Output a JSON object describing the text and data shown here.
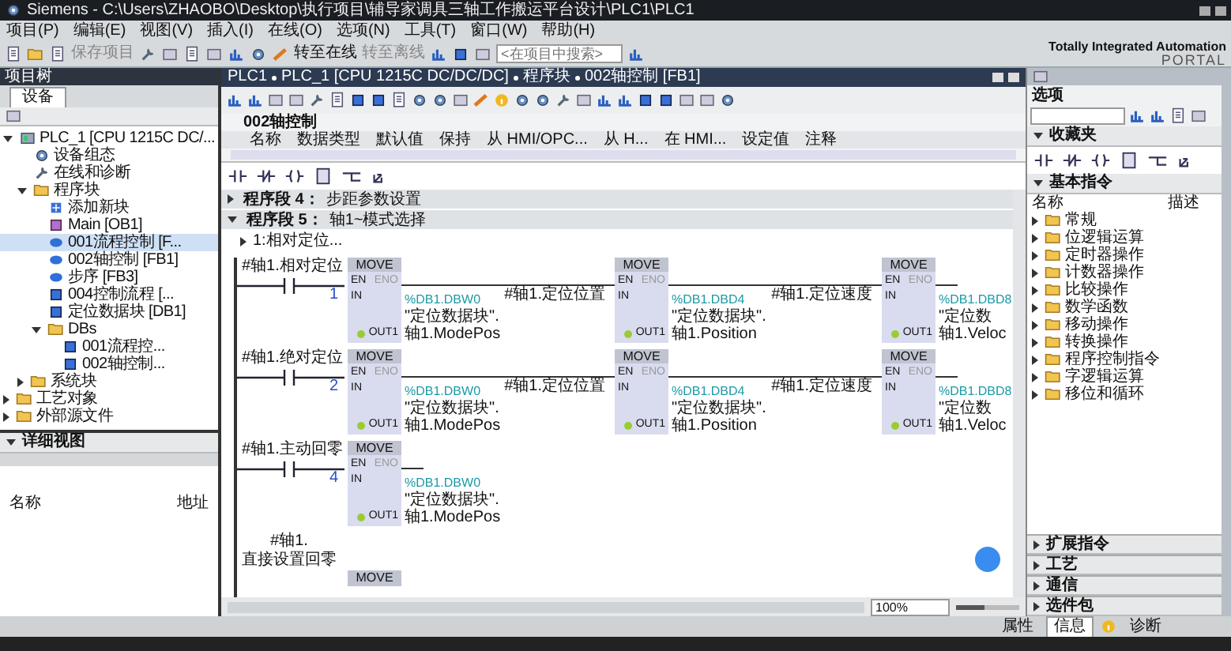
{
  "window": {
    "title": "Siemens - C:\\Users\\ZHAOBO\\Desktop\\执行项目\\辅导家调具三轴工作搬运平台设计\\PLC1\\PLC1"
  },
  "menu": [
    "项目(P)",
    "编辑(E)",
    "视图(V)",
    "插入(I)",
    "在线(O)",
    "选项(N)",
    "工具(T)",
    "窗口(W)",
    "帮助(H)"
  ],
  "toolbar": {
    "buttons": [
      {
        "label": "保存项目",
        "disabled": true
      },
      {
        "label": "转至在线",
        "disabled": false
      },
      {
        "label": "转至离线",
        "disabled": true
      }
    ],
    "search": {
      "placeholder": "<在项目中搜索>"
    },
    "brand": [
      "Totally Integrated Automation",
      "PORTAL"
    ]
  },
  "project_tree": {
    "title": "项目树",
    "tabs": [
      {
        "label": "设备",
        "selected": true
      }
    ],
    "items": [
      {
        "label": "PLC_1 [CPU 1215C DC/...",
        "kind": "device",
        "selected": false,
        "expanded": true,
        "children": [
          {
            "label": "设备组态",
            "kind": "config",
            "selected": false
          },
          {
            "label": "在线和诊断",
            "kind": "diag",
            "selected": false
          },
          {
            "label": "程序块",
            "kind": "folder",
            "selected": false,
            "expanded": true,
            "children": [
              {
                "label": "添加新块",
                "kind": "add",
                "selected": false
              },
              {
                "label": "Main [OB1]",
                "kind": "ob",
                "selected": false
              },
              {
                "label": "001流程控制 [F...",
                "kind": "fb",
                "selected": true
              },
              {
                "label": "002轴控制 [FB1]",
                "kind": "fb",
                "selected": false
              },
              {
                "label": "步序 [FB3]",
                "kind": "fb",
                "selected": false
              },
              {
                "label": "004控制流程 [...",
                "kind": "db",
                "selected": false
              },
              {
                "label": "定位数据块 [DB1]",
                "kind": "db",
                "selected": false
              },
              {
                "label": "DBs",
                "kind": "folder",
                "selected": false,
                "expanded": true,
                "children": [
                  {
                    "label": "001流程控...",
                    "kind": "db",
                    "selected": false
                  },
                  {
                    "label": "002轴控制...",
                    "kind": "db",
                    "selected": false
                  }
                ]
              }
            ]
          },
          {
            "label": "系统块",
            "kind": "folder",
            "selected": false,
            "expanded": false
          }
        ]
      },
      {
        "label": "工艺对象",
        "kind": "folder",
        "selected": false,
        "expanded": false
      },
      {
        "label": "外部源文件",
        "kind": "folder",
        "selected": false,
        "expanded": false
      }
    ]
  },
  "detail_view": {
    "title": "详细视图",
    "columns": [
      "名称",
      "地址"
    ]
  },
  "editor": {
    "breadcrumb": [
      "PLC1",
      "PLC_1 [CPU 1215C DC/DC/DC]",
      "程序块",
      "002轴控制 [FB1]"
    ],
    "block_title": "002轴控制",
    "interface_columns": [
      "名称",
      "数据类型",
      "默认值",
      "保持",
      "从 HMI/OPC...",
      "从 H...",
      "在 HMI...",
      "设定值",
      "注释"
    ],
    "networks": [
      {
        "label": "程序段 4：",
        "comment": "步距参数设置",
        "expanded": false
      },
      {
        "label": "程序段 5：",
        "comment": "轴1~模式选择",
        "expanded": true
      }
    ],
    "network_comment": "1:相对定位...",
    "rungs": [
      {
        "contact": "#轴1.相对定位",
        "moves": [
          {
            "title": "MOVE",
            "en": "EN",
            "eno": "ENO",
            "in_pin": "IN",
            "out_pin": "OUT1",
            "in": {
              "text": "1",
              "kind": "constant"
            },
            "out_address": "%DB1.DBW0",
            "out_block": "\"定位数据块\".",
            "out_member": "轴1.ModePos"
          },
          {
            "title": "MOVE",
            "en": "EN",
            "eno": "ENO",
            "in_pin": "IN",
            "out_pin": "OUT1",
            "in": {
              "text": "#轴1.定位位置",
              "kind": "tag"
            },
            "out_address": "%DB1.DBD4",
            "out_block": "\"定位数据块\".",
            "out_member": "轴1.Position"
          },
          {
            "title": "MOVE",
            "en": "EN",
            "eno": "ENO",
            "in_pin": "IN",
            "out_pin": "OUT1",
            "in": {
              "text": "#轴1.定位速度",
              "kind": "tag"
            },
            "out_address": "%DB1.DBD8",
            "out_block": "\"定位数",
            "out_member": "轴1.Veloc"
          }
        ]
      },
      {
        "contact": "#轴1.绝对定位",
        "moves": [
          {
            "title": "MOVE",
            "en": "EN",
            "eno": "ENO",
            "in_pin": "IN",
            "out_pin": "OUT1",
            "in": {
              "text": "2",
              "kind": "constant"
            },
            "out_address": "%DB1.DBW0",
            "out_block": "\"定位数据块\".",
            "out_member": "轴1.ModePos"
          },
          {
            "title": "MOVE",
            "en": "EN",
            "eno": "ENO",
            "in_pin": "IN",
            "out_pin": "OUT1",
            "in": {
              "text": "#轴1.定位位置",
              "kind": "tag"
            },
            "out_address": "%DB1.DBD4",
            "out_block": "\"定位数据块\".",
            "out_member": "轴1.Position"
          },
          {
            "title": "MOVE",
            "en": "EN",
            "eno": "ENO",
            "in_pin": "IN",
            "out_pin": "OUT1",
            "in": {
              "text": "#轴1.定位速度",
              "kind": "tag"
            },
            "out_address": "%DB1.DBD8",
            "out_block": "\"定位数",
            "out_member": "轴1.Veloc"
          }
        ]
      },
      {
        "contact": "#轴1.主动回零",
        "moves": [
          {
            "title": "MOVE",
            "en": "EN",
            "eno": "ENO",
            "in_pin": "IN",
            "out_pin": "OUT1",
            "in": {
              "text": "4",
              "kind": "constant"
            },
            "out_address": "%DB1.DBW0",
            "out_block": "\"定位数据块\".",
            "out_member": "轴1.ModePos"
          }
        ]
      },
      {
        "contact": "#轴1.\n直接设置回零",
        "moves": [
          {
            "title": "MOVE"
          }
        ]
      }
    ],
    "zoom": "100%",
    "zoom_slider": {
      "level": 0.45
    }
  },
  "instructions": {
    "title": "选项",
    "favorites": "收藏夹",
    "basic": {
      "title": "基本指令",
      "columns": [
        "名称",
        "描述"
      ],
      "folders": [
        "常规",
        "位逻辑运算",
        "定时器操作",
        "计数器操作",
        "比较操作",
        "数学函数",
        "移动操作",
        "转换操作",
        "程序控制指令",
        "字逻辑运算",
        "移位和循环"
      ]
    },
    "sections": [
      "扩展指令",
      "工艺",
      "通信",
      "选件包"
    ]
  },
  "status_bar": {
    "tabs": [
      {
        "label": "属性",
        "selected": false
      },
      {
        "label": "信息",
        "selected": true
      },
      {
        "label": "诊断",
        "selected": false
      }
    ]
  }
}
